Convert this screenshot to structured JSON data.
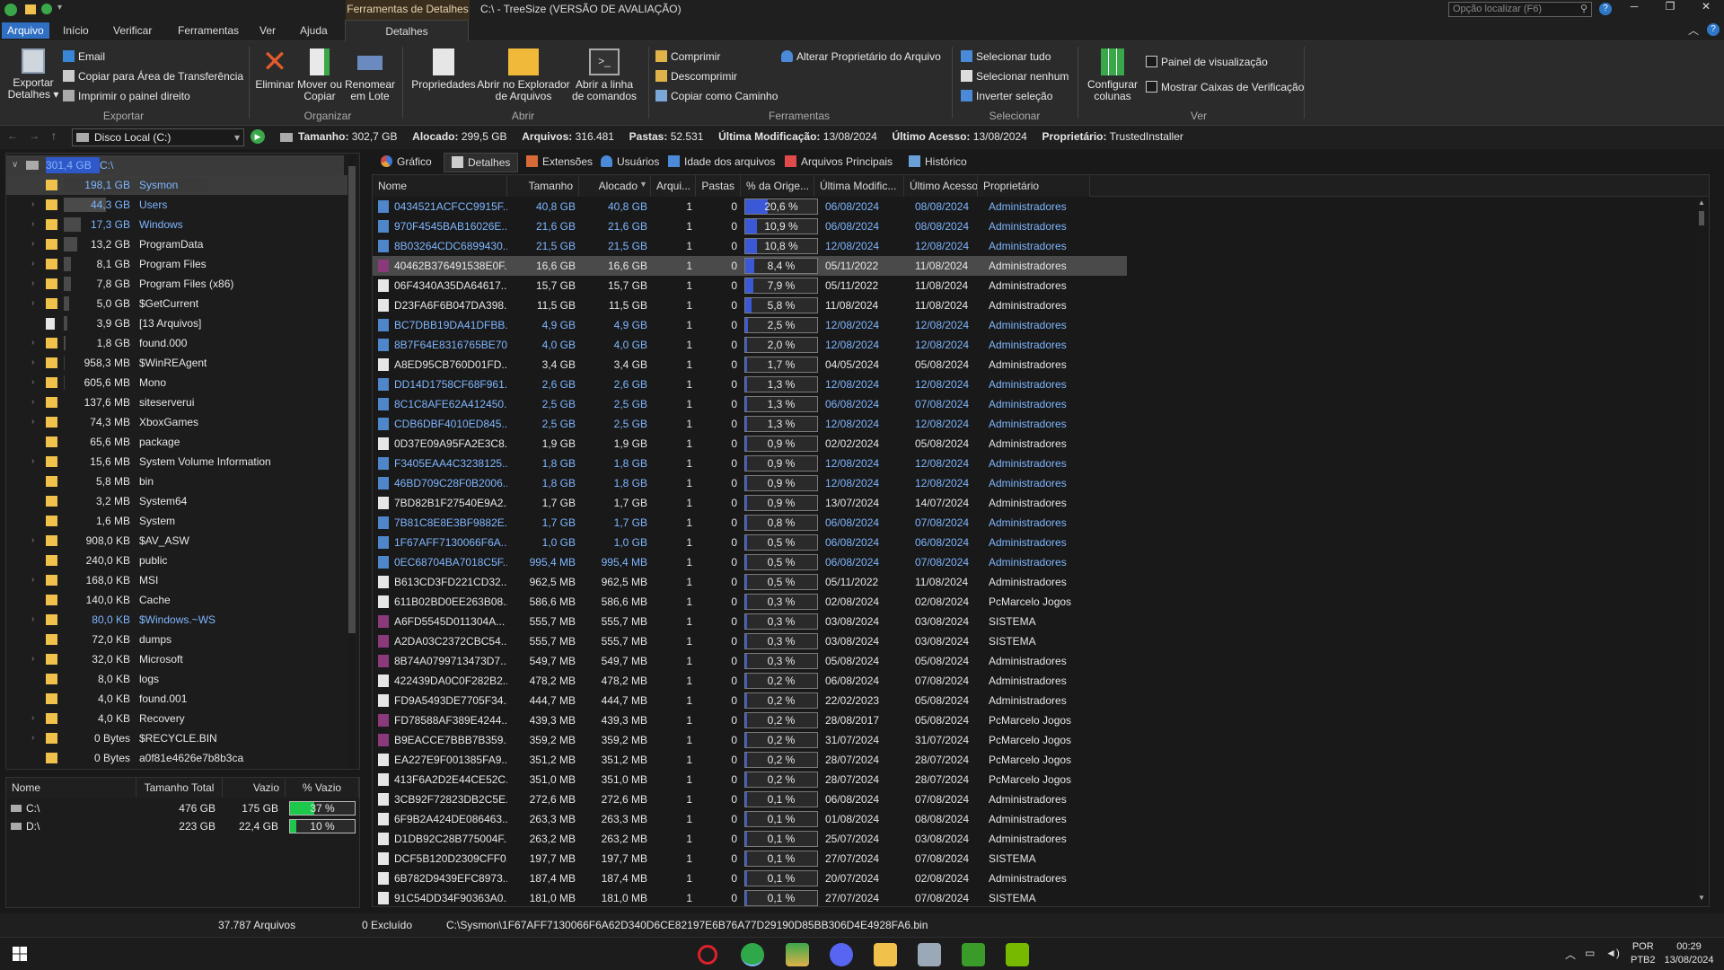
{
  "window": {
    "title": "C:\\ - TreeSize  (VERSÃO DE AVALIAÇÃO)",
    "context_tab": "Ferramentas de Detalhes",
    "search_placeholder": "Opção localizar (F6)",
    "help": "?"
  },
  "menu": {
    "items": [
      "Arquivo",
      "Início",
      "Verificar",
      "Ferramentas",
      "Ver",
      "Ajuda",
      "Detalhes"
    ],
    "active": "Arquivo",
    "context_active": "Detalhes"
  },
  "ribbon": {
    "export": {
      "big": "Exportar Detalhes",
      "email": "Email",
      "copy": "Copiar para Área de Transferência",
      "print": "Imprimir o painel direito",
      "label": "Exportar"
    },
    "organize": {
      "delete": "Eliminar",
      "move": "Mover ou Copiar",
      "rename": "Renomear em Lote",
      "label": "Organizar"
    },
    "open": {
      "props": "Propriedades",
      "explorer": "Abrir no Explorador de Arquivos",
      "cmd": "Abrir a linha de comandos",
      "label": "Abrir"
    },
    "tools": {
      "compress": "Comprimir",
      "decompress": "Descomprimir",
      "copypath": "Copiar como Caminho",
      "owner": "Alterar Proprietário do Arquivo",
      "label": "Ferramentas"
    },
    "select": {
      "all": "Selecionar tudo",
      "none": "Selecionar nenhum",
      "invert": "Inverter seleção",
      "label": "Selecionar"
    },
    "view": {
      "cols": "Configurar colunas",
      "preview": "Painel de visualização",
      "checkbox": "Mostrar Caixas de Verificação",
      "label": "Ver"
    }
  },
  "address": {
    "drive": "Disco Local (C:)",
    "size_label": "Tamanho:",
    "size": "302,7 GB",
    "alloc_label": "Alocado:",
    "alloc": "299,5 GB",
    "files_label": "Arquivos:",
    "files": "316.481",
    "folders_label": "Pastas:",
    "folders": "52.531",
    "mod_label": "Última Modificação:",
    "mod": "13/08/2024",
    "acc_label": "Último Acesso:",
    "acc": "13/08/2024",
    "owner_label": "Proprietário:",
    "owner": "TrustedInstaller"
  },
  "tree": {
    "root": {
      "size": "301,4 GB",
      "name": "C:\\"
    },
    "items": [
      {
        "size": "198,1 GB",
        "name": "Sysmon",
        "fill": 1.0,
        "sel": true,
        "exp": ""
      },
      {
        "size": "44,3 GB",
        "name": "Users",
        "fill": 0.22,
        "blue": true,
        "exp": "›"
      },
      {
        "size": "17,3 GB",
        "name": "Windows",
        "fill": 0.09,
        "blue": true,
        "exp": "›"
      },
      {
        "size": "13,2 GB",
        "name": "ProgramData",
        "fill": 0.07,
        "exp": "›"
      },
      {
        "size": "8,1 GB",
        "name": "Program Files",
        "fill": 0.04,
        "exp": "›"
      },
      {
        "size": "7,8 GB",
        "name": "Program Files (x86)",
        "fill": 0.04,
        "exp": "›"
      },
      {
        "size": "5,0 GB",
        "name": "$GetCurrent",
        "fill": 0.03,
        "exp": "›"
      },
      {
        "size": "3,9 GB",
        "name": "[13 Arquivos]",
        "fill": 0.02,
        "exp": "",
        "file": true
      },
      {
        "size": "1,8 GB",
        "name": "found.000",
        "fill": 0.01,
        "exp": "›"
      },
      {
        "size": "958,3 MB",
        "name": "$WinREAgent",
        "fill": 0.005,
        "exp": "›"
      },
      {
        "size": "605,6 MB",
        "name": "Mono",
        "fill": 0.003,
        "exp": "›"
      },
      {
        "size": "137,6 MB",
        "name": "siteserverui",
        "fill": 0.001,
        "exp": "›"
      },
      {
        "size": "74,3 MB",
        "name": "XboxGames",
        "fill": 0.001,
        "exp": "›"
      },
      {
        "size": "65,6 MB",
        "name": "package",
        "fill": 0.001,
        "exp": ""
      },
      {
        "size": "15,6 MB",
        "name": "System Volume Information",
        "fill": 0,
        "exp": "›"
      },
      {
        "size": "5,8 MB",
        "name": "bin",
        "fill": 0,
        "exp": ""
      },
      {
        "size": "3,2 MB",
        "name": "System64",
        "fill": 0,
        "exp": ""
      },
      {
        "size": "1,6 MB",
        "name": "System",
        "fill": 0,
        "exp": ""
      },
      {
        "size": "908,0 KB",
        "name": "$AV_ASW",
        "fill": 0,
        "exp": "›"
      },
      {
        "size": "240,0 KB",
        "name": "public",
        "fill": 0,
        "exp": ""
      },
      {
        "size": "168,0 KB",
        "name": "MSI",
        "fill": 0,
        "exp": "›"
      },
      {
        "size": "140,0 KB",
        "name": "Cache",
        "fill": 0,
        "exp": ""
      },
      {
        "size": "80,0 KB",
        "name": "$Windows.~WS",
        "fill": 0,
        "blue": true,
        "exp": "›"
      },
      {
        "size": "72,0 KB",
        "name": "dumps",
        "fill": 0,
        "exp": ""
      },
      {
        "size": "32,0 KB",
        "name": "Microsoft",
        "fill": 0,
        "exp": "›"
      },
      {
        "size": "8,0 KB",
        "name": "logs",
        "fill": 0,
        "exp": ""
      },
      {
        "size": "4,0 KB",
        "name": "found.001",
        "fill": 0,
        "exp": ""
      },
      {
        "size": "4,0 KB",
        "name": "Recovery",
        "fill": 0,
        "exp": "›"
      },
      {
        "size": "0 Bytes",
        "name": "$RECYCLE.BIN",
        "fill": 0,
        "exp": "›"
      },
      {
        "size": "0 Bytes",
        "name": "a0f81e4626e7b8b3ca",
        "fill": 0,
        "exp": ""
      }
    ]
  },
  "drives": {
    "headers": [
      "Nome",
      "Tamanho Total",
      "Vazio",
      "% Vazio"
    ],
    "rows": [
      {
        "name": "C:\\",
        "total": "476 GB",
        "free": "175 GB",
        "pct": "37 %",
        "fill": 0.37
      },
      {
        "name": "D:\\",
        "total": "223 GB",
        "free": "22,4 GB",
        "pct": "10 %",
        "fill": 0.1
      }
    ]
  },
  "tabs": [
    "Gráfico",
    "Detalhes",
    "Extensões",
    "Usuários",
    "Idade dos arquivos",
    "Arquivos Principais",
    "Histórico"
  ],
  "tabs_active": "Detalhes",
  "columns": [
    "Nome",
    "Tamanho",
    "Alocado",
    "Arqui...",
    "Pastas",
    "% da Orige...",
    "Última Modific...",
    "Último Acesso",
    "Proprietário"
  ],
  "rows": [
    [
      "0434521ACFCC9915F...",
      "40,8 GB",
      "40,8 GB",
      "1",
      "0",
      "20,6 %",
      0.206,
      "06/08/2024",
      "08/08/2024",
      "Administradores",
      "blue"
    ],
    [
      "970F4545BAB16026E...",
      "21,6 GB",
      "21,6 GB",
      "1",
      "0",
      "10,9 %",
      0.109,
      "06/08/2024",
      "08/08/2024",
      "Administradores",
      "blue"
    ],
    [
      "8B03264CDC6899430...",
      "21,5 GB",
      "21,5 GB",
      "1",
      "0",
      "10,8 %",
      0.108,
      "12/08/2024",
      "12/08/2024",
      "Administradores",
      "blue"
    ],
    [
      "40462B376491538E0F...",
      "16,6 GB",
      "16,6 GB",
      "1",
      "0",
      "8,4 %",
      0.084,
      "05/11/2022",
      "11/08/2024",
      "Administradores",
      "rar"
    ],
    [
      "06F4340A35DA64617...",
      "15,7 GB",
      "15,7 GB",
      "1",
      "0",
      "7,9 %",
      0.079,
      "05/11/2022",
      "11/08/2024",
      "Administradores",
      "white"
    ],
    [
      "D23FA6F6B047DA398...",
      "11,5 GB",
      "11,5 GB",
      "1",
      "0",
      "5,8 %",
      0.058,
      "11/08/2024",
      "11/08/2024",
      "Administradores",
      "white"
    ],
    [
      "BC7DBB19DA41DFBB...",
      "4,9 GB",
      "4,9 GB",
      "1",
      "0",
      "2,5 %",
      0.025,
      "12/08/2024",
      "12/08/2024",
      "Administradores",
      "blue"
    ],
    [
      "8B7F64E8316765BE70...",
      "4,0 GB",
      "4,0 GB",
      "1",
      "0",
      "2,0 %",
      0.02,
      "12/08/2024",
      "12/08/2024",
      "Administradores",
      "blue"
    ],
    [
      "A8ED95CB760D01FD...",
      "3,4 GB",
      "3,4 GB",
      "1",
      "0",
      "1,7 %",
      0.017,
      "04/05/2024",
      "05/08/2024",
      "Administradores",
      "white"
    ],
    [
      "DD14D1758CF68F961...",
      "2,6 GB",
      "2,6 GB",
      "1",
      "0",
      "1,3 %",
      0.013,
      "12/08/2024",
      "12/08/2024",
      "Administradores",
      "blue"
    ],
    [
      "8C1C8AFE62A412450...",
      "2,5 GB",
      "2,5 GB",
      "1",
      "0",
      "1,3 %",
      0.013,
      "06/08/2024",
      "07/08/2024",
      "Administradores",
      "blue"
    ],
    [
      "CDB6DBF4010ED845...",
      "2,5 GB",
      "2,5 GB",
      "1",
      "0",
      "1,3 %",
      0.013,
      "12/08/2024",
      "12/08/2024",
      "Administradores",
      "blue"
    ],
    [
      "0D37E09A95FA2E3C8...",
      "1,9 GB",
      "1,9 GB",
      "1",
      "0",
      "0,9 %",
      0.009,
      "02/02/2024",
      "05/08/2024",
      "Administradores",
      "white"
    ],
    [
      "F3405EAA4C3238125...",
      "1,8 GB",
      "1,8 GB",
      "1",
      "0",
      "0,9 %",
      0.009,
      "12/08/2024",
      "12/08/2024",
      "Administradores",
      "blue"
    ],
    [
      "46BD709C28F0B2006...",
      "1,8 GB",
      "1,8 GB",
      "1",
      "0",
      "0,9 %",
      0.009,
      "12/08/2024",
      "12/08/2024",
      "Administradores",
      "blue"
    ],
    [
      "7BD82B1F27540E9A2...",
      "1,7 GB",
      "1,7 GB",
      "1",
      "0",
      "0,9 %",
      0.009,
      "13/07/2024",
      "14/07/2024",
      "Administradores",
      "white"
    ],
    [
      "7B81C8E8E3BF9882E...",
      "1,7 GB",
      "1,7 GB",
      "1",
      "0",
      "0,8 %",
      0.008,
      "06/08/2024",
      "07/08/2024",
      "Administradores",
      "blue"
    ],
    [
      "1F67AFF7130066F6A...",
      "1,0 GB",
      "1,0 GB",
      "1",
      "0",
      "0,5 %",
      0.005,
      "06/08/2024",
      "06/08/2024",
      "Administradores",
      "blue"
    ],
    [
      "0EC68704BA7018C5F...",
      "995,4 MB",
      "995,4 MB",
      "1",
      "0",
      "0,5 %",
      0.005,
      "06/08/2024",
      "07/08/2024",
      "Administradores",
      "blue"
    ],
    [
      "B613CD3FD221CD32...",
      "962,5 MB",
      "962,5 MB",
      "1",
      "0",
      "0,5 %",
      0.005,
      "05/11/2022",
      "11/08/2024",
      "Administradores",
      "white"
    ],
    [
      "611B02BD0EE263B08...",
      "586,6 MB",
      "586,6 MB",
      "1",
      "0",
      "0,3 %",
      0.003,
      "02/08/2024",
      "02/08/2024",
      "PcMarcelo Jogos",
      "white"
    ],
    [
      "A6FD5545D011304A...",
      "555,7 MB",
      "555,7 MB",
      "1",
      "0",
      "0,3 %",
      0.003,
      "03/08/2024",
      "03/08/2024",
      "SISTEMA",
      "rar"
    ],
    [
      "A2DA03C2372CBC54...",
      "555,7 MB",
      "555,7 MB",
      "1",
      "0",
      "0,3 %",
      0.003,
      "03/08/2024",
      "03/08/2024",
      "SISTEMA",
      "rar"
    ],
    [
      "8B74A0799713473D7...",
      "549,7 MB",
      "549,7 MB",
      "1",
      "0",
      "0,3 %",
      0.003,
      "05/08/2024",
      "05/08/2024",
      "Administradores",
      "rar"
    ],
    [
      "422439DA0C0F282B2...",
      "478,2 MB",
      "478,2 MB",
      "1",
      "0",
      "0,2 %",
      0.002,
      "06/08/2024",
      "07/08/2024",
      "Administradores",
      "white"
    ],
    [
      "FD9A5493DE7705F34...",
      "444,7 MB",
      "444,7 MB",
      "1",
      "0",
      "0,2 %",
      0.002,
      "22/02/2023",
      "05/08/2024",
      "Administradores",
      "white"
    ],
    [
      "FD78588AF389E4244...",
      "439,3 MB",
      "439,3 MB",
      "1",
      "0",
      "0,2 %",
      0.002,
      "28/08/2017",
      "05/08/2024",
      "PcMarcelo Jogos",
      "rar"
    ],
    [
      "B9EACCE7BBB7B359...",
      "359,2 MB",
      "359,2 MB",
      "1",
      "0",
      "0,2 %",
      0.002,
      "31/07/2024",
      "31/07/2024",
      "PcMarcelo Jogos",
      "rar"
    ],
    [
      "EA227E9F001385FA9...",
      "351,2 MB",
      "351,2 MB",
      "1",
      "0",
      "0,2 %",
      0.002,
      "28/07/2024",
      "28/07/2024",
      "PcMarcelo Jogos",
      "white"
    ],
    [
      "413F6A2D2E44CE52C...",
      "351,0 MB",
      "351,0 MB",
      "1",
      "0",
      "0,2 %",
      0.002,
      "28/07/2024",
      "28/07/2024",
      "PcMarcelo Jogos",
      "white"
    ],
    [
      "3CB92F72823DB2C5E...",
      "272,6 MB",
      "272,6 MB",
      "1",
      "0",
      "0,1 %",
      0.001,
      "06/08/2024",
      "07/08/2024",
      "Administradores",
      "white"
    ],
    [
      "6F9B2A424DE086463...",
      "263,3 MB",
      "263,3 MB",
      "1",
      "0",
      "0,1 %",
      0.001,
      "01/08/2024",
      "08/08/2024",
      "Administradores",
      "white"
    ],
    [
      "D1DB92C28B775004F...",
      "263,2 MB",
      "263,2 MB",
      "1",
      "0",
      "0,1 %",
      0.001,
      "25/07/2024",
      "03/08/2024",
      "Administradores",
      "white"
    ],
    [
      "DCF5B120D2309CFF0...",
      "197,7 MB",
      "197,7 MB",
      "1",
      "0",
      "0,1 %",
      0.001,
      "27/07/2024",
      "07/08/2024",
      "SISTEMA",
      "white"
    ],
    [
      "6B782D9439EFC8973...",
      "187,4 MB",
      "187,4 MB",
      "1",
      "0",
      "0,1 %",
      0.001,
      "20/07/2024",
      "02/08/2024",
      "Administradores",
      "white"
    ],
    [
      "91C54DD34F90363A0...",
      "181,0 MB",
      "181,0 MB",
      "1",
      "0",
      "0,1 %",
      0.001,
      "27/07/2024",
      "07/08/2024",
      "SISTEMA",
      "white"
    ]
  ],
  "status": {
    "files": "37.787 Arquivos",
    "excluded": "0 Excluído",
    "path": "C:\\Sysmon\\1F67AFF7130066F6A62D340D6CE82197E6B76A77D29190D85BB306D4E4928FA6.bin"
  },
  "taskbar": {
    "lang1": "POR",
    "lang2": "PTB2",
    "time": "00:29",
    "date": "13/08/2024"
  },
  "colors": {
    "accent": "#3b58d6",
    "folder": "#f0c14b",
    "link": "#7fb6ff",
    "selected": "#4a4a4a",
    "drive_fill": "#1ec84a"
  }
}
